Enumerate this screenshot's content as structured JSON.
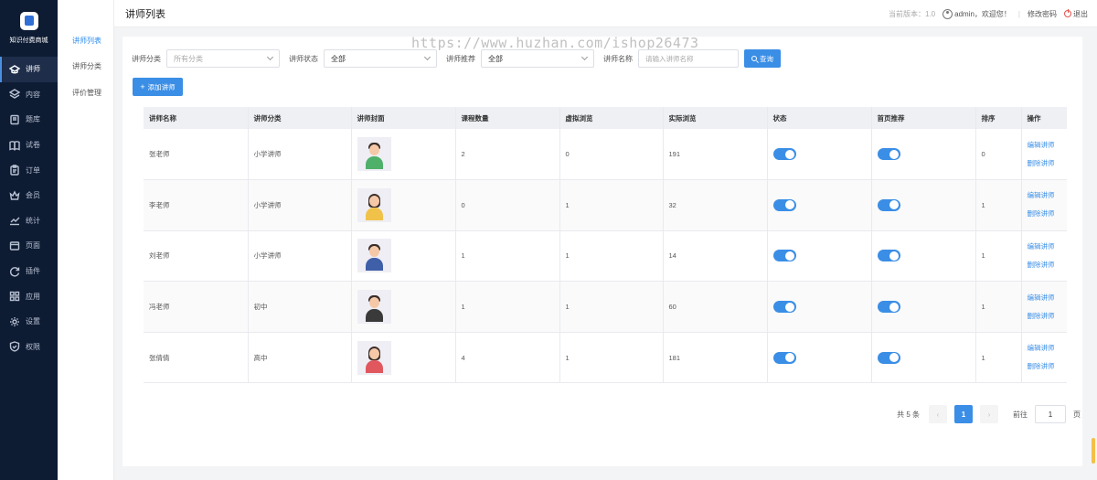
{
  "brand": {
    "name": "知识付费商城"
  },
  "nav": {
    "items": [
      {
        "label": "讲师",
        "icon": "graduation-cap-icon",
        "active": true
      },
      {
        "label": "内容",
        "icon": "layers-icon"
      },
      {
        "label": "题库",
        "icon": "book-icon"
      },
      {
        "label": "试卷",
        "icon": "open-book-icon"
      },
      {
        "label": "订单",
        "icon": "clipboard-icon"
      },
      {
        "label": "会员",
        "icon": "crown-icon"
      },
      {
        "label": "统计",
        "icon": "line-chart-icon"
      },
      {
        "label": "页面",
        "icon": "window-icon"
      },
      {
        "label": "插件",
        "icon": "refresh-icon"
      },
      {
        "label": "应用",
        "icon": "grid-icon"
      },
      {
        "label": "设置",
        "icon": "gear-icon"
      },
      {
        "label": "权限",
        "icon": "shield-icon"
      }
    ]
  },
  "submenu": {
    "items": [
      {
        "label": "讲师列表",
        "active": true
      },
      {
        "label": "讲师分类"
      },
      {
        "label": "评价管理"
      }
    ]
  },
  "header": {
    "title": "讲师列表",
    "version": "当前版本：1.0",
    "greeting": "admin，欢迎您！",
    "separator": "|",
    "change_password": "修改密码",
    "logout": "退出"
  },
  "watermark": "https://www.huzhan.com/ishop26473",
  "filters": {
    "category_label": "讲师分类",
    "category_placeholder": "所有分类",
    "status_label": "讲师状态",
    "status_value": "全部",
    "recommend_label": "讲师推荐",
    "recommend_value": "全部",
    "name_label": "讲师名称",
    "name_placeholder": "请输入讲师名称",
    "search_label": "查询"
  },
  "add_button": "添加讲师",
  "table": {
    "columns": [
      "讲师名称",
      "讲师分类",
      "讲师封面",
      "课程数量",
      "虚拟浏览",
      "实际浏览",
      "状态",
      "首页推荐",
      "排序",
      "操作"
    ],
    "rows": [
      {
        "name": "张老师",
        "category": "小学讲师",
        "courses": "2",
        "virtual_views": "0",
        "actual_views": "191",
        "sort": "0",
        "status_on": true,
        "recommend_on": true,
        "shirt": "#4fb06a"
      },
      {
        "name": "李老师",
        "category": "小学讲师",
        "courses": "0",
        "virtual_views": "1",
        "actual_views": "32",
        "sort": "1",
        "status_on": true,
        "recommend_on": true,
        "shirt": "#f0c24a"
      },
      {
        "name": "刘老师",
        "category": "小学讲师",
        "courses": "1",
        "virtual_views": "1",
        "actual_views": "14",
        "sort": "1",
        "status_on": true,
        "recommend_on": true,
        "shirt": "#3f5fa8"
      },
      {
        "name": "冯老师",
        "category": "初中",
        "courses": "1",
        "virtual_views": "1",
        "actual_views": "60",
        "sort": "1",
        "status_on": true,
        "recommend_on": true,
        "shirt": "#3a3a3a"
      },
      {
        "name": "张倩倩",
        "category": "高中",
        "courses": "4",
        "virtual_views": "1",
        "actual_views": "181",
        "sort": "1",
        "status_on": true,
        "recommend_on": true,
        "shirt": "#e0575e"
      }
    ],
    "edit_label": "编辑讲师",
    "delete_label": "删除讲师"
  },
  "pagination": {
    "total": "共 5 条",
    "prev": "‹",
    "current": "1",
    "next": "›",
    "goto_label": "前往",
    "goto_value": "1",
    "page_suffix": "页"
  },
  "colors": {
    "accent": "#3a8ee6",
    "sidebar": "#0d1b33",
    "link": "#3a8ee6"
  }
}
